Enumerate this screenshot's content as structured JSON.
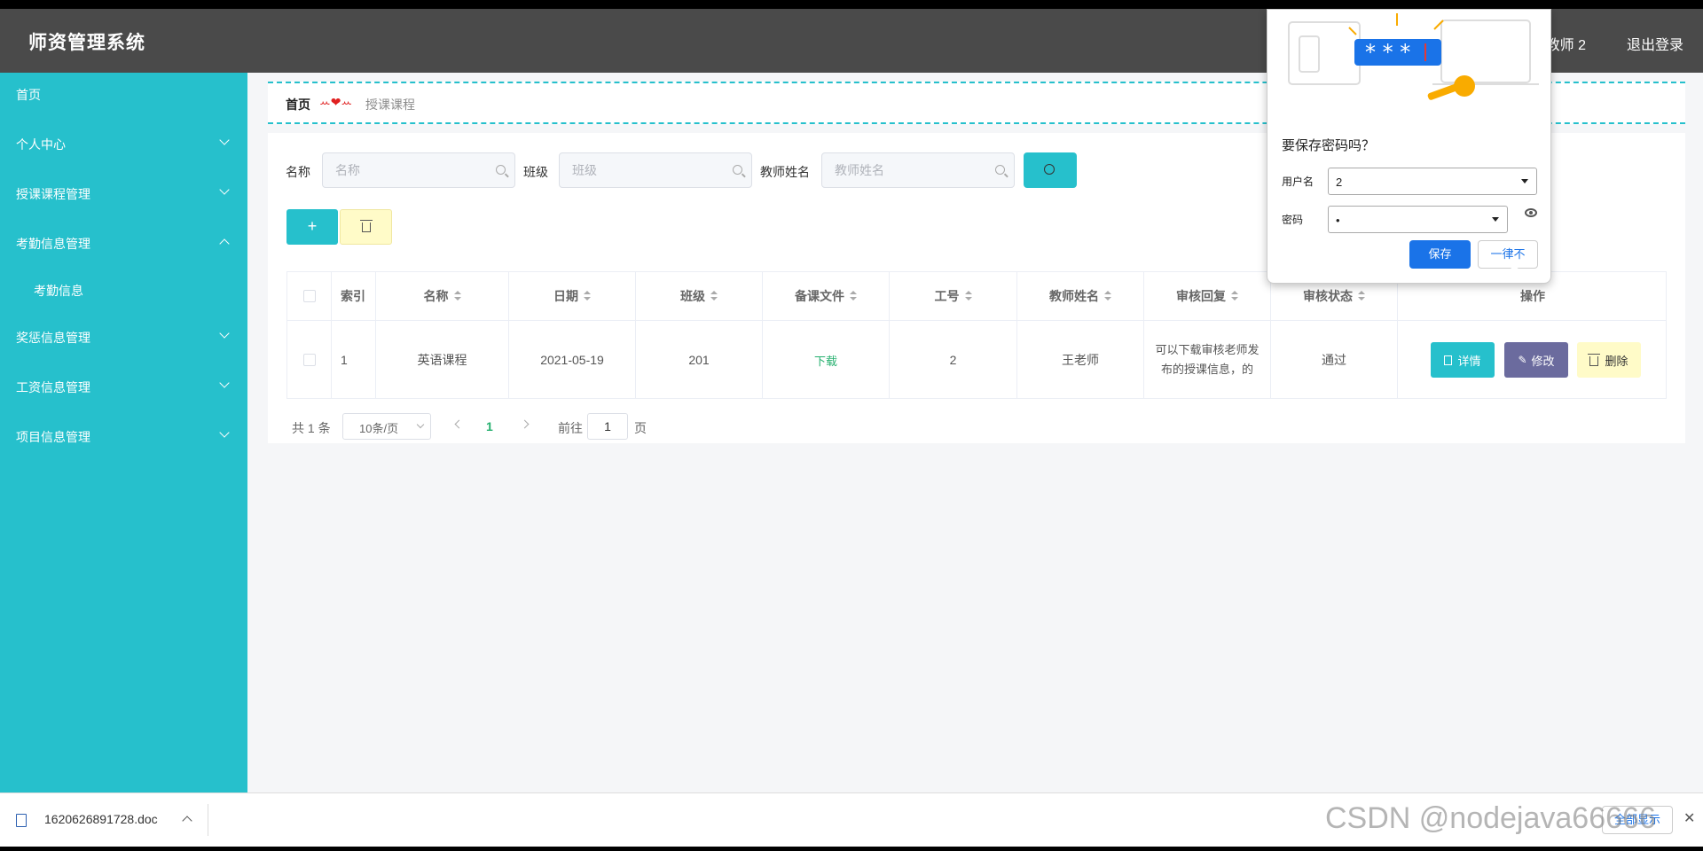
{
  "app": {
    "title": "师资管理系统",
    "user": "教师 2",
    "logout": "退出登录"
  },
  "sidebar": {
    "items": [
      {
        "label": "首页"
      },
      {
        "label": "个人中心"
      },
      {
        "label": "授课课程管理"
      },
      {
        "label": "考勤信息管理"
      },
      {
        "label": "考勤信息"
      },
      {
        "label": "奖惩信息管理"
      },
      {
        "label": "工资信息管理"
      },
      {
        "label": "项目信息管理"
      }
    ]
  },
  "breadcrumb": {
    "home": "首页",
    "separator": "ꕀ❤ꕀ",
    "current": "授课课程"
  },
  "search": {
    "name_label": "名称",
    "name_placeholder": "名称",
    "class_label": "班级",
    "class_placeholder": "班级",
    "teacher_label": "教师姓名",
    "teacher_placeholder": "教师姓名"
  },
  "toolbar": {
    "add": "+"
  },
  "table": {
    "headers": [
      "索引",
      "名称",
      "日期",
      "班级",
      "备课文件",
      "工号",
      "教师姓名",
      "审核回复",
      "审核状态",
      "操作"
    ],
    "rows": [
      {
        "index": "1",
        "name": "英语课程",
        "date": "2021-05-19",
        "class": "201",
        "file": "下载",
        "job_no": "2",
        "teacher": "王老师",
        "reply": "可以下载审核老师发布的授课信息，的",
        "status": "通过"
      }
    ],
    "actions": {
      "detail": "详情",
      "edit": "修改",
      "delete": "删除"
    }
  },
  "pager": {
    "total": "共 1 条",
    "size": "10条/页",
    "current": "1",
    "goto": "前往",
    "goto_value": "1",
    "page": "页"
  },
  "password_popup": {
    "question": "要保存密码吗？",
    "username_label": "用户名",
    "username_value": "2",
    "password_label": "密码",
    "password_value": "•",
    "save": "保存",
    "never": "一律不"
  },
  "download_bar": {
    "file": "1620626891728.doc",
    "show_all": "全部显示"
  },
  "watermark": "CSDN @nodejava66666",
  "colors": {
    "accent": "#26c0cc",
    "header": "#4a4a4a",
    "edit": "#6b6b9e",
    "delete": "#fffbc8",
    "link": "#26b06f",
    "chrome_blue": "#1a73e8"
  }
}
